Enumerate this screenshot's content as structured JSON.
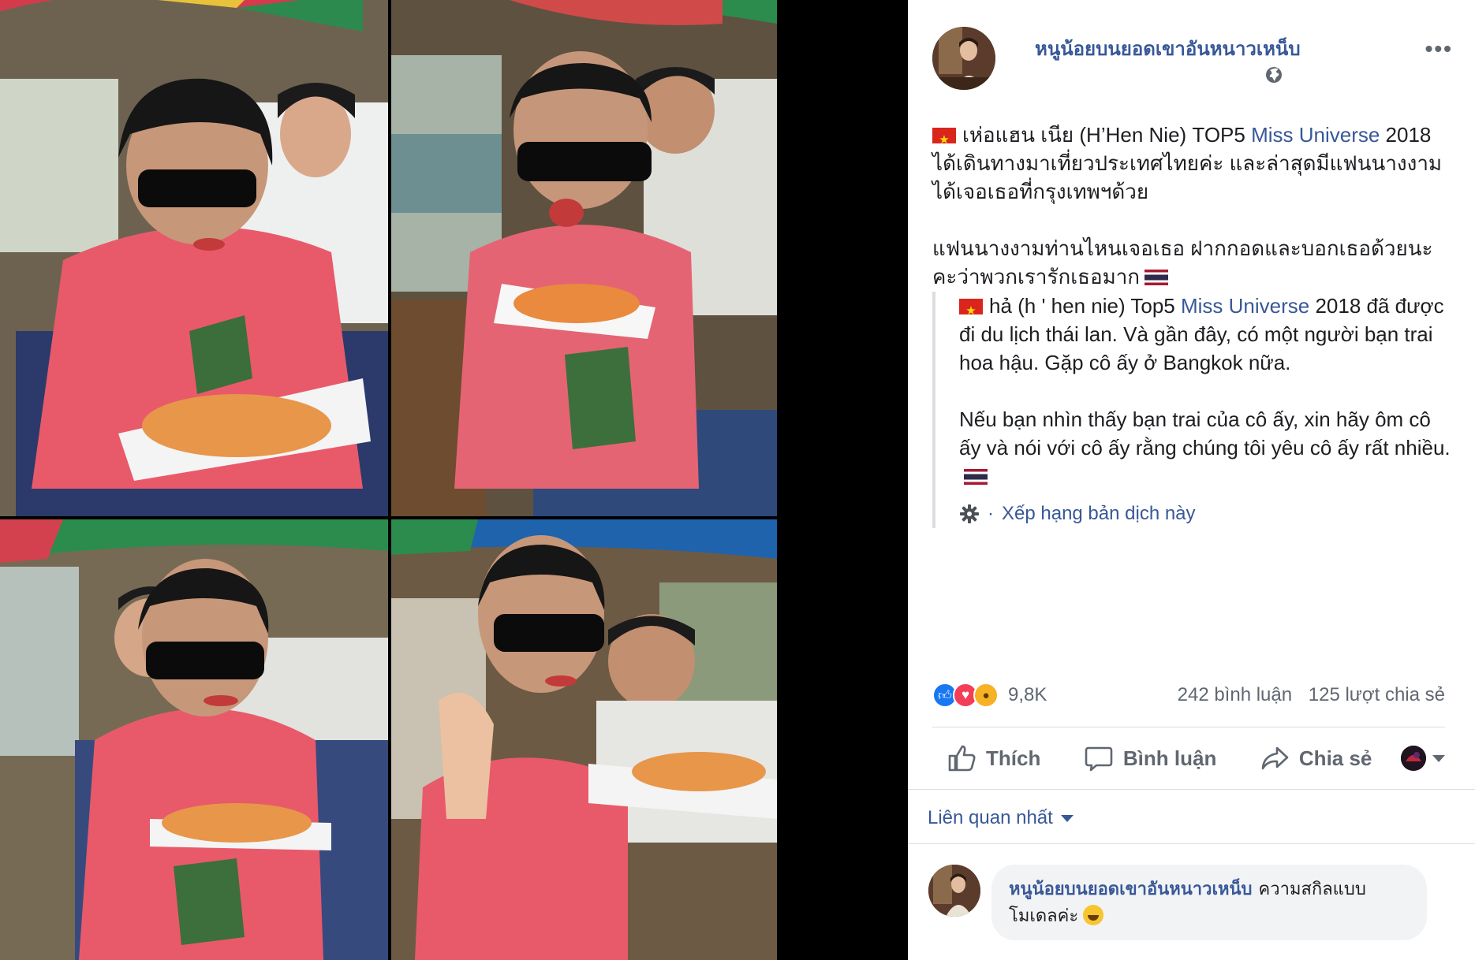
{
  "photos": [
    {
      "label": "photo-top-left"
    },
    {
      "label": "photo-top-right"
    },
    {
      "label": "photo-bottom-left"
    },
    {
      "label": "photo-bottom-right"
    }
  ],
  "post": {
    "author": "หนูน้อยบนยอดเขาอันหนาวเหน็บ",
    "more": "•••",
    "caption": {
      "p1_before_link": "เห่อแฮน เนีย (H’Hen Nie) TOP5 ",
      "p1_link": "Miss Universe",
      "p1_after_link": " 2018 ได้เดินทางมาเที่ยวประเทศไทยค่ะ และล่าสุดมีแฟนนางงามได้เจอเธอที่กรุงเทพฯด้วย",
      "p2": "แฟนนางงามท่านไหนเจอเธอ ฝากกอดและบอกเธอด้วยนะคะว่าพวกเรารักเธอมาก"
    },
    "translation": {
      "p1_before_link": "hả (h ' hen nie) Top5 ",
      "p1_link": "Miss Universe",
      "p1_after_link": " 2018 đã được đi du lịch thái lan. Và gần đây, có một người bạn trai hoa hậu. Gặp cô ấy ở Bangkok nữa.",
      "p2": "Nếu bạn nhìn thấy bạn trai của cô ấy, xin hãy ôm cô ấy và nói với cô ấy rằng chúng tôi yêu cô ấy rất nhiều.",
      "rate_label": "Xếp hạng bản dịch này"
    },
    "reactions": {
      "count": "9,8K",
      "comments": "242 bình luận",
      "shares": "125 lượt chia sẻ"
    },
    "actions": {
      "like": "Thích",
      "comment": "Bình luận",
      "share": "Chia sẻ"
    },
    "sort_label": "Liên quan nhất",
    "comment": {
      "author": "หนูน้อยบนยอดเขาอันหนาวเหน็บ",
      "text": "ความสกิลแบบโมเดลค่ะ"
    }
  },
  "colors": {
    "link": "#385898",
    "secondary_text": "#606770",
    "like_blue": "#1877f2",
    "love_red": "#f33e58",
    "wow_yellow": "#f7b125"
  }
}
